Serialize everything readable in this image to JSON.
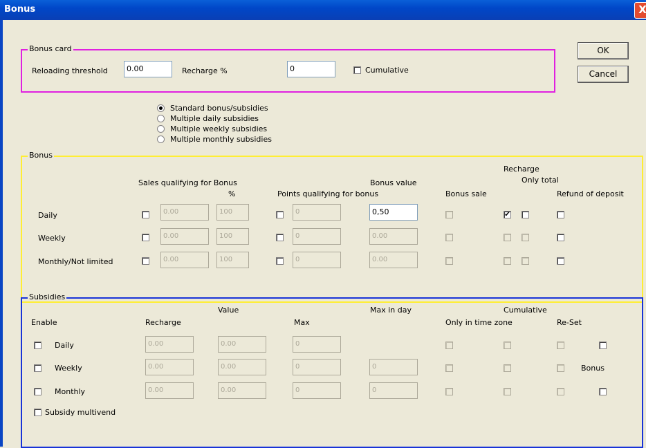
{
  "window": {
    "title": "Bonus",
    "close_glyph": "X"
  },
  "buttons": {
    "ok": "OK",
    "cancel": "Cancel"
  },
  "bonus_card": {
    "group_label": "Bonus card",
    "reload_label": "Reloading threshold",
    "reload_value": "0.00",
    "recharge_label": "Recharge %",
    "recharge_value": "0",
    "cumulative_label": "Cumulative"
  },
  "mode": {
    "standard": "Standard bonus/subsidies",
    "daily": "Multiple daily subsidies",
    "weekly": "Multiple weekly subsidies",
    "monthly": "Multiple monthly subsidies",
    "selected": "standard"
  },
  "bonus": {
    "group_label": "Bonus",
    "hdr_sales": "Sales qualifying for Bonus",
    "hdr_pct": "%",
    "hdr_points": "Points qualifying for bonus",
    "hdr_value": "Bonus value",
    "hdr_sale": "Bonus sale",
    "hdr_recharge": "Recharge",
    "hdr_only_total": "Only total",
    "hdr_refund": "Refund of deposit",
    "rows": [
      {
        "label": "Daily",
        "sales": "0.00",
        "pct": "100",
        "points": "0",
        "value": "0,50"
      },
      {
        "label": "Weekly",
        "sales": "0.00",
        "pct": "100",
        "points": "0",
        "value": "0.00"
      },
      {
        "label": "Monthly/Not limited",
        "sales": "0.00",
        "pct": "100",
        "points": "0",
        "value": "0.00"
      }
    ]
  },
  "subsidies": {
    "group_label": "Subsidies",
    "hdr_value": "Value",
    "hdr_max_day": "Max in day",
    "hdr_cumulative": "Cumulative",
    "hdr_enable": "Enable",
    "hdr_recharge": "Recharge",
    "hdr_max": "Max",
    "hdr_time_zone": "Only in time zone",
    "hdr_reset": "Re-Set",
    "bonus_label": "Bonus",
    "multivend": "Subsidy multivend",
    "rows": [
      {
        "label": "Daily",
        "recharge": "0.00",
        "value": "0.00",
        "max": "0"
      },
      {
        "label": "Weekly",
        "recharge": "0.00",
        "value": "0.00",
        "max": "0",
        "max_day": "0"
      },
      {
        "label": "Monthly",
        "recharge": "0.00",
        "value": "0.00",
        "max": "0",
        "max_day": "0"
      }
    ]
  }
}
